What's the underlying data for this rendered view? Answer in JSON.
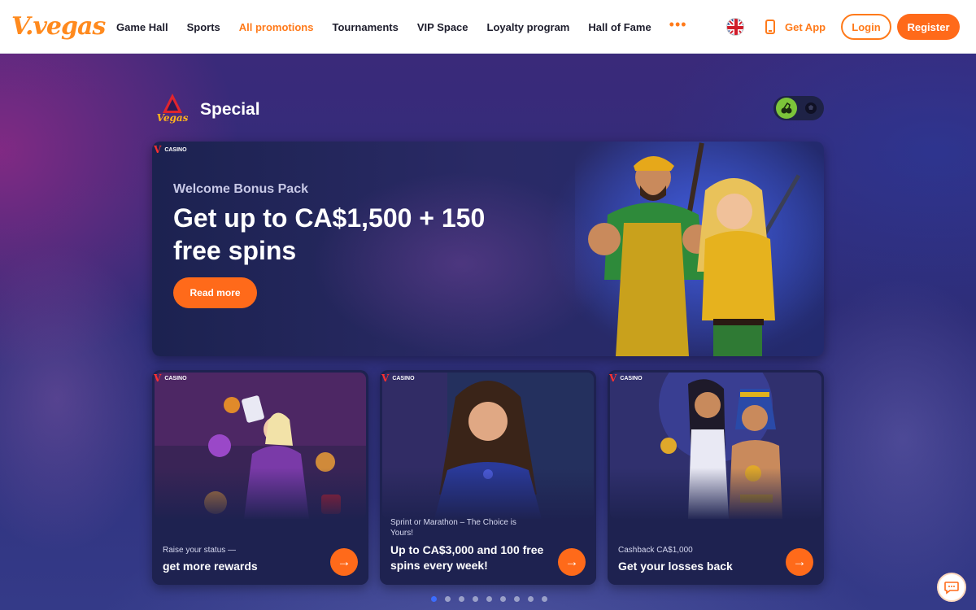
{
  "header": {
    "logo_text": "V.vegas",
    "nav": [
      {
        "label": "Game Hall",
        "active": false
      },
      {
        "label": "Sports",
        "active": false
      },
      {
        "label": "All promotions",
        "active": true
      },
      {
        "label": "Tournaments",
        "active": false
      },
      {
        "label": "VIP Space",
        "active": false
      },
      {
        "label": "Loyalty program",
        "active": false
      },
      {
        "label": "Hall of Fame",
        "active": false
      }
    ],
    "more_label": "•••",
    "language": "English (UK flag)",
    "get_app_label": "Get App",
    "login_label": "Login",
    "register_label": "Register"
  },
  "section": {
    "logo_text": "Vegas",
    "title": "Special",
    "toggle": {
      "active": "casino",
      "options": [
        "casino-icon",
        "sports-ball-icon"
      ]
    }
  },
  "hero": {
    "tag": "CASINO",
    "tag_mark": "V",
    "subtitle": "Welcome Bonus Pack",
    "title": "Get up to CA$1,500 + 150 free spins",
    "button_label": "Read more"
  },
  "cards": [
    {
      "tag": "CASINO",
      "tag_mark": "V",
      "small": "Raise your status —",
      "big": "get more rewards"
    },
    {
      "tag": "CASINO",
      "tag_mark": "V",
      "small": "Sprint or Marathon – The Choice is Yours!",
      "big": "Up to CA$3,000 and 100 free spins every week!"
    },
    {
      "tag": "CASINO",
      "tag_mark": "V",
      "small": "Cashback CA$1,000",
      "big": "Get your losses back"
    }
  ],
  "carousel": {
    "page_count": 9,
    "active_index": 0
  },
  "colors": {
    "accent": "#ff6a1a",
    "active_nav": "#ff7a1a",
    "toggle_on": "#7cc43a",
    "dot_active": "#3c6dff"
  }
}
